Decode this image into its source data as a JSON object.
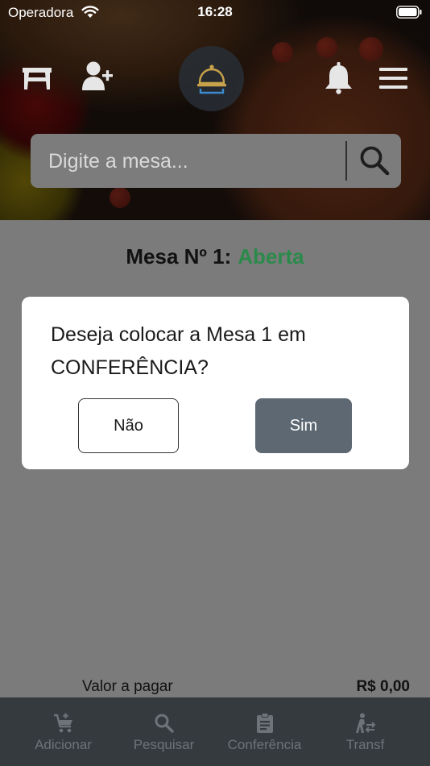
{
  "status_bar": {
    "carrier": "Operadora",
    "time": "16:28"
  },
  "header": {
    "icons": [
      "table-icon",
      "add-user-icon",
      "service-bell-icon",
      "notification-bell-icon",
      "menu-icon"
    ]
  },
  "search": {
    "placeholder": "Digite a mesa..."
  },
  "mesa": {
    "label": "Mesa Nº 1:",
    "status": "Aberta",
    "status_color": "#2b8a4b"
  },
  "dialog": {
    "message": "Deseja colocar a Mesa 1 em CONFERÊNCIA?",
    "no_label": "Não",
    "yes_label": "Sim",
    "yes_color": "#5d6873"
  },
  "summary": {
    "label": "Valor a pagar",
    "value": "R$ 0,00"
  },
  "tabs": [
    {
      "label": "Adicionar",
      "icon": "cart-add-icon"
    },
    {
      "label": "Pesquisar",
      "icon": "search-icon"
    },
    {
      "label": "Conferência",
      "icon": "clipboard-icon"
    },
    {
      "label": "Transf",
      "icon": "transfer-icon"
    }
  ]
}
